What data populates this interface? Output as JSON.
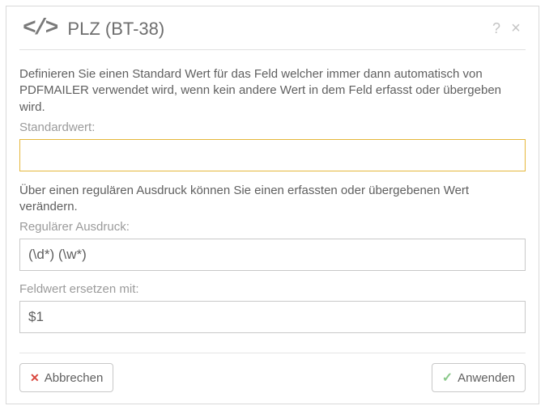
{
  "header": {
    "title": "PLZ (BT-38)",
    "help": "?",
    "close": "×"
  },
  "body": {
    "desc1": "Definieren Sie einen Standard Wert für das Feld welcher immer dann automatisch von PDFMAILER verwendet wird, wenn kein andere Wert in dem Feld erfasst oder übergeben wird.",
    "label1": "Standardwert:",
    "value1": "",
    "desc2": "Über einen regulären Ausdruck können Sie einen erfassten oder übergebenen Wert verändern.",
    "label2": "Regulärer Ausdruck:",
    "value2": "(\\d*) (\\w*)",
    "label3": "Feldwert ersetzen mit:",
    "value3": "$1"
  },
  "footer": {
    "cancel": "Abbrechen",
    "apply": "Anwenden"
  }
}
